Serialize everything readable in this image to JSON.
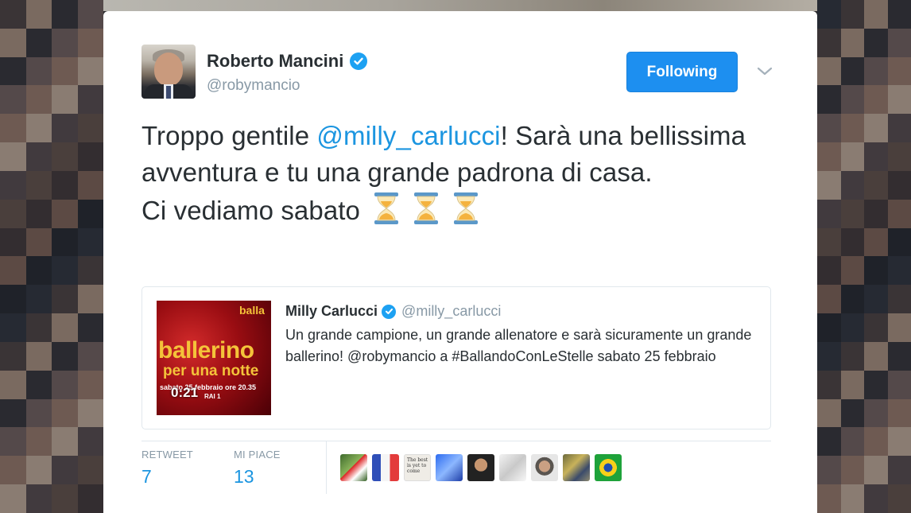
{
  "tweet": {
    "author_name": "Roberto Mancini",
    "author_handle": "@robymancio",
    "follow_label": "Following",
    "text_before_mention": "Troppo gentile ",
    "mention": "@milly_carlucci",
    "text_after_mention": "! Sarà una bellissima avventura e tu una grande padrona di casa.",
    "line2": "Ci vediamo sabato",
    "emoji": [
      "hourglass-icon",
      "hourglass-icon",
      "hourglass-icon"
    ]
  },
  "quoted": {
    "author_name": "Milly Carlucci",
    "author_handle": "@milly_carlucci",
    "text": "Un grande campione, un grande allenatore e sarà sicuramente un grande ballerino! @robymancio a #BallandoConLeStelle sabato 25 febbraio",
    "thumb": {
      "logo": "balla",
      "title": "ballerino",
      "subtitle": "per una notte",
      "date_line": "sabato 25 febbraio ore 20.35",
      "channel": "RAI 1",
      "duration": "0:21"
    }
  },
  "stats": {
    "retweet_label": "RETWEET",
    "retweet_count": "7",
    "likes_label": "MI PIACE",
    "likes_count": "13"
  },
  "likers_text": {
    "book_cover": "The best is yet to come"
  },
  "colors": {
    "accent": "#1b95e0",
    "button": "#1d8ff0",
    "text": "#292f33",
    "muted": "#8899a6"
  }
}
